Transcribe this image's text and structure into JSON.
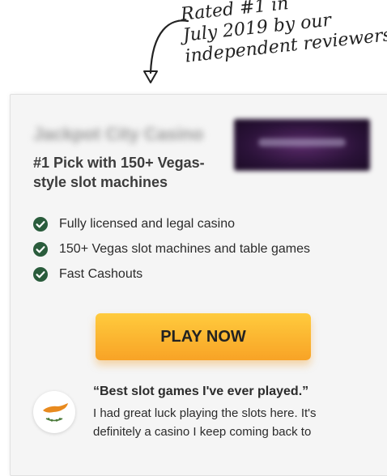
{
  "annotation": {
    "lines": [
      "Rated #1 in",
      "July 2019 by our",
      "independent reviewers"
    ]
  },
  "offer": {
    "casino_name": "Jackpot City Casino",
    "headline": "#1 Pick with 150+ Vegas-style slot machines",
    "features": [
      "Fully licensed and legal casino",
      "150+ Vegas slot machines and table games",
      "Fast Cashouts"
    ],
    "cta_label": "PLAY NOW"
  },
  "review": {
    "quote_title": "“Best slot games I've ever played.”",
    "quote_text": "I had great luck playing the slots here. It's definitely a casino I keep coming back to"
  },
  "colors": {
    "accent_button": "#f8a326",
    "check_icon": "#2a5c3c",
    "cyprus_map": "#e88a1f",
    "olive_branch": "#4a7a3a"
  },
  "icons": {
    "feature_check": "check-circle-icon",
    "reviewer_avatar": "cyprus-flag-icon",
    "annotation_arrow": "hand-drawn-arrow-icon"
  }
}
